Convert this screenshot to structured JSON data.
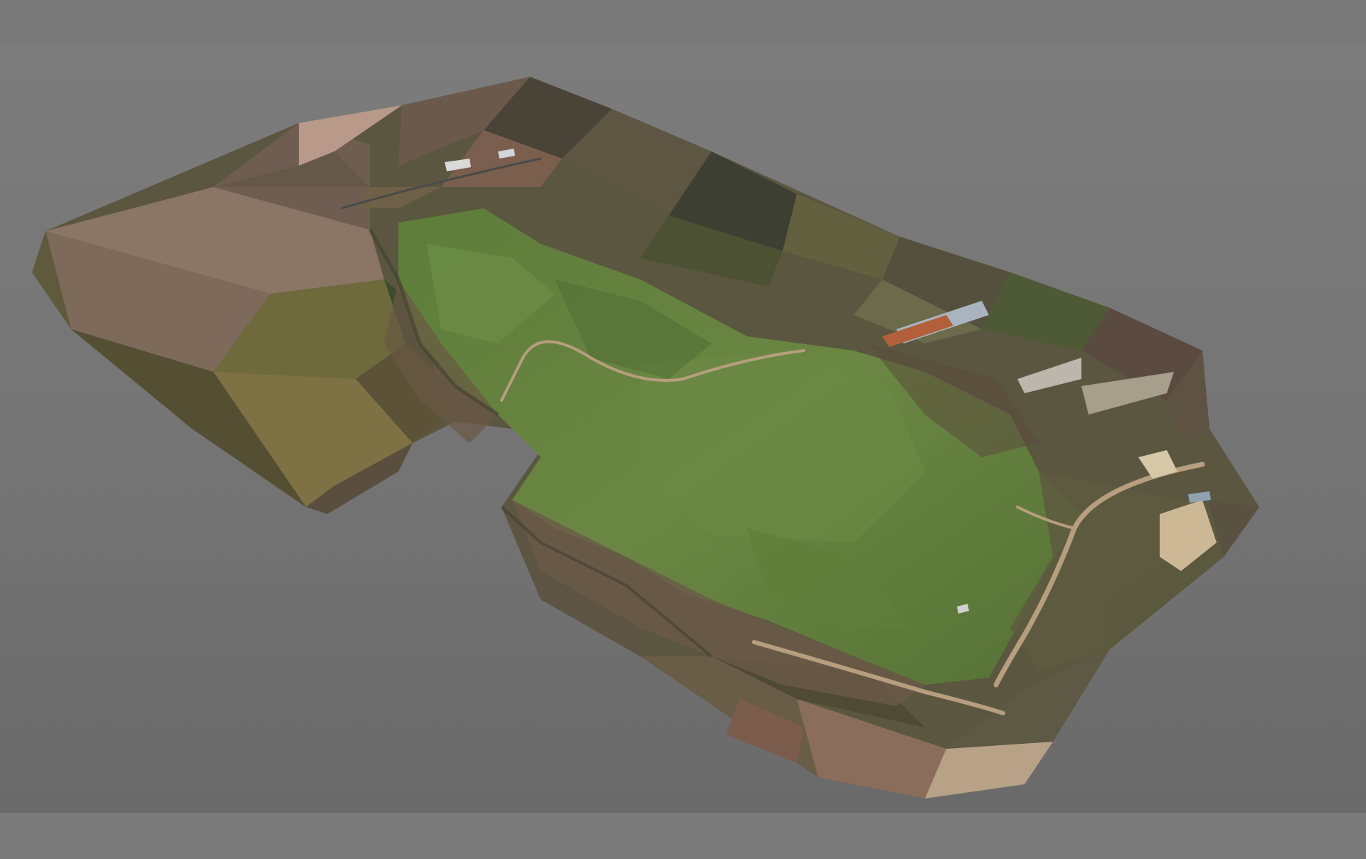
{
  "viewport": {
    "background_color": "#767676",
    "model": {
      "type": "textured-terrain-mesh",
      "description_hidden": true,
      "colors": {
        "grass": "#5c7a3a",
        "grass_light": "#6e8c45",
        "terrain_brown": "#6b5d4a",
        "terrain_dark": "#3e4033",
        "terrain_olive": "#6f6a3e",
        "terrain_pink": "#9a8276",
        "path": "#b8a182",
        "rock": "#c9b79a"
      }
    }
  }
}
